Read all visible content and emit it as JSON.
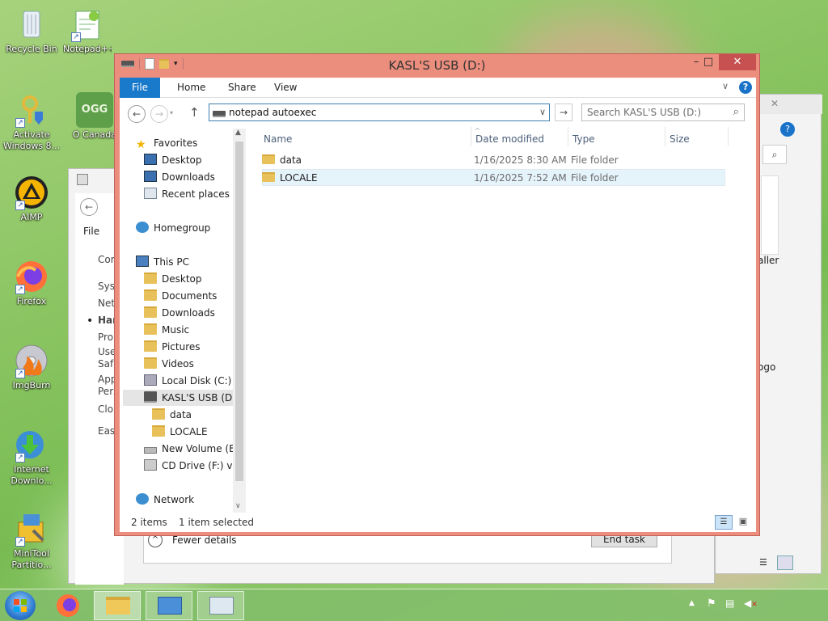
{
  "desktop": {
    "icons": [
      {
        "label": "Recycle Bin"
      },
      {
        "label": "Notepad++"
      },
      {
        "label": "Activate Windows 8..."
      },
      {
        "label": "OGG"
      },
      {
        "label": "O Canada"
      },
      {
        "label": "AIMP"
      },
      {
        "label": "Firefox"
      },
      {
        "label": "ImgBurn"
      },
      {
        "label": "Internet Downlo..."
      },
      {
        "label": "MiniTool Partitio..."
      }
    ]
  },
  "background_windows": {
    "left_panel_items": [
      "File",
      "Cor",
      "Syst",
      "Net",
      "Har",
      "Pro",
      "Use",
      "Safe",
      "App",
      "Pers",
      "Clo",
      "Eas"
    ],
    "right_fragments": [
      "aller",
      "ogo"
    ],
    "fewer_details": "Fewer details",
    "end_task": "End task"
  },
  "window": {
    "title": "KASL'S USB (D:)",
    "min": "–",
    "max": "□",
    "close": "✕",
    "tabs": {
      "file": "File",
      "home": "Home",
      "share": "Share",
      "view": "View"
    },
    "address": {
      "value": "notepad autoexec"
    },
    "search": {
      "placeholder": "Search KASL'S USB (D:)"
    },
    "nav": [
      {
        "label": "Favorites"
      },
      {
        "label": "Desktop"
      },
      {
        "label": "Downloads"
      },
      {
        "label": "Recent places"
      },
      {
        "label": "Homegroup"
      },
      {
        "label": "This PC"
      },
      {
        "label": "Desktop"
      },
      {
        "label": "Documents"
      },
      {
        "label": "Downloads"
      },
      {
        "label": "Music"
      },
      {
        "label": "Pictures"
      },
      {
        "label": "Videos"
      },
      {
        "label": "Local Disk (C:)"
      },
      {
        "label": "KASL'S USB (D:)"
      },
      {
        "label": "data"
      },
      {
        "label": "LOCALE"
      },
      {
        "label": "New Volume (E:)"
      },
      {
        "label": "CD Drive (F:) virti"
      },
      {
        "label": "Network"
      }
    ],
    "columns": {
      "name": "Name",
      "date": "Date modified",
      "type": "Type",
      "size": "Size"
    },
    "files": [
      {
        "name": "data",
        "date": "1/16/2025 8:30 AM",
        "type": "File folder",
        "size": ""
      },
      {
        "name": "LOCALE",
        "date": "1/16/2025 7:52 AM",
        "type": "File folder",
        "size": ""
      }
    ],
    "status": {
      "count": "2 items",
      "selected": "1 item selected"
    }
  },
  "colors": {
    "accent": "#1979ca",
    "window_frame": "#ec8e7d",
    "close": "#c75050"
  }
}
